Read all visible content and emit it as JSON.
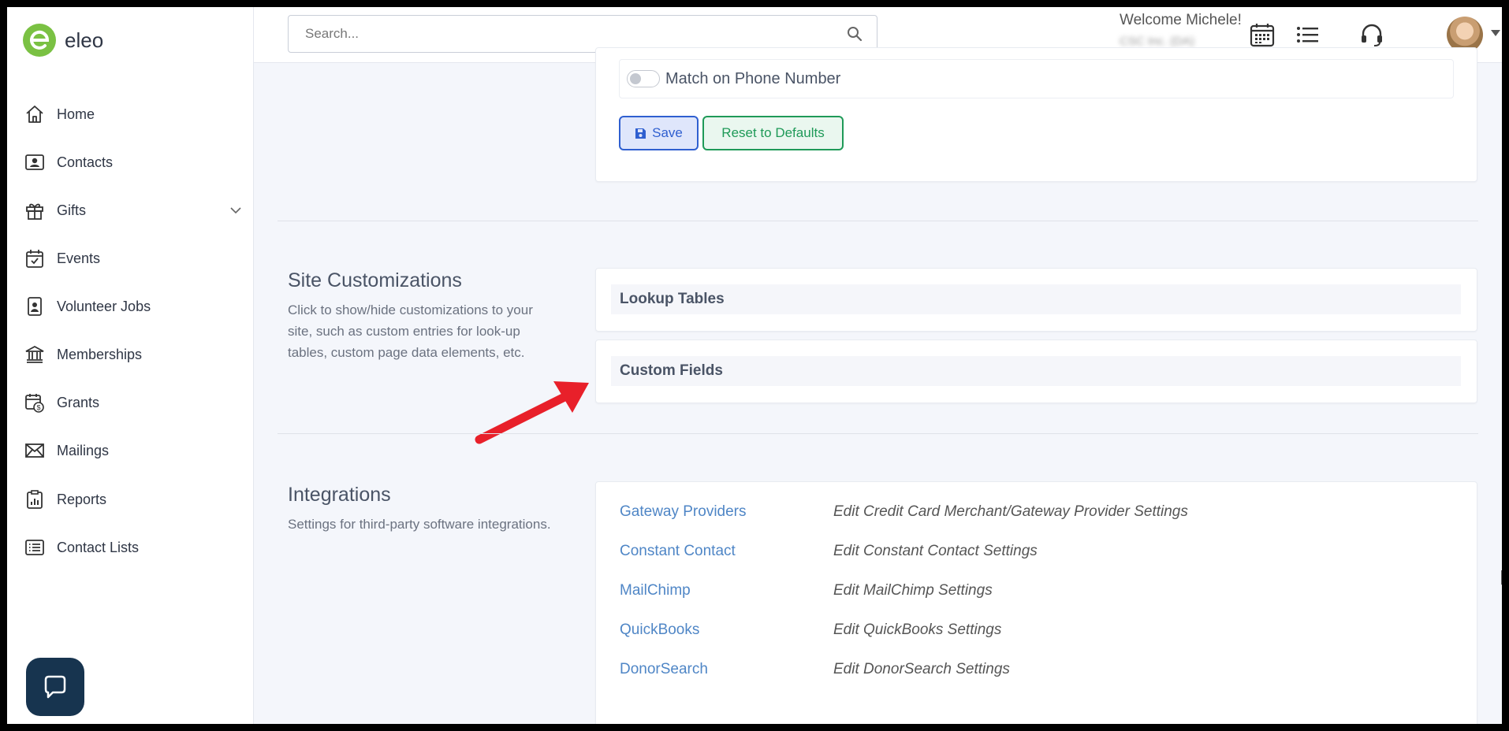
{
  "app": {
    "logo_text": "eleo",
    "brand_color": "#7ac143"
  },
  "sidebar": {
    "items": [
      {
        "label": "Home",
        "icon": "home-icon"
      },
      {
        "label": "Contacts",
        "icon": "contact-card-icon"
      },
      {
        "label": "Gifts",
        "icon": "gift-icon",
        "expandable": true
      },
      {
        "label": "Events",
        "icon": "calendar-check-icon"
      },
      {
        "label": "Volunteer Jobs",
        "icon": "badge-icon"
      },
      {
        "label": "Memberships",
        "icon": "bank-icon"
      },
      {
        "label": "Grants",
        "icon": "grant-calendar-icon"
      },
      {
        "label": "Mailings",
        "icon": "envelope-icon"
      },
      {
        "label": "Reports",
        "icon": "report-icon"
      },
      {
        "label": "Contact Lists",
        "icon": "list-icon"
      }
    ]
  },
  "header": {
    "search_placeholder": "Search...",
    "welcome": "Welcome Michele!",
    "org_name": "CSC Inc. (DA)"
  },
  "matching": {
    "phone_toggle_label": "Match on Phone Number",
    "phone_toggle_on": false,
    "save_label": "Save",
    "reset_label": "Reset to Defaults"
  },
  "site_customizations": {
    "title": "Site Customizations",
    "description": "Click to show/hide customizations to your site, such as custom entries for look-up tables, custom page data elements, etc.",
    "panels": [
      "Lookup Tables",
      "Custom Fields"
    ]
  },
  "integrations": {
    "title": "Integrations",
    "description": "Settings for third-party software integrations.",
    "items": [
      {
        "name": "Gateway Providers",
        "desc": "Edit Credit Card Merchant/Gateway Provider Settings"
      },
      {
        "name": "Constant Contact",
        "desc": "Edit Constant Contact Settings"
      },
      {
        "name": "MailChimp",
        "desc": "Edit MailChimp Settings"
      },
      {
        "name": "QuickBooks",
        "desc": "Edit QuickBooks Settings"
      },
      {
        "name": "DonorSearch",
        "desc": "Edit DonorSearch Settings"
      }
    ]
  },
  "colors": {
    "link": "#4f86c6",
    "save_blue": "#2f5fd0",
    "reset_green": "#1f9a58",
    "annotation_arrow": "#e8202a"
  }
}
